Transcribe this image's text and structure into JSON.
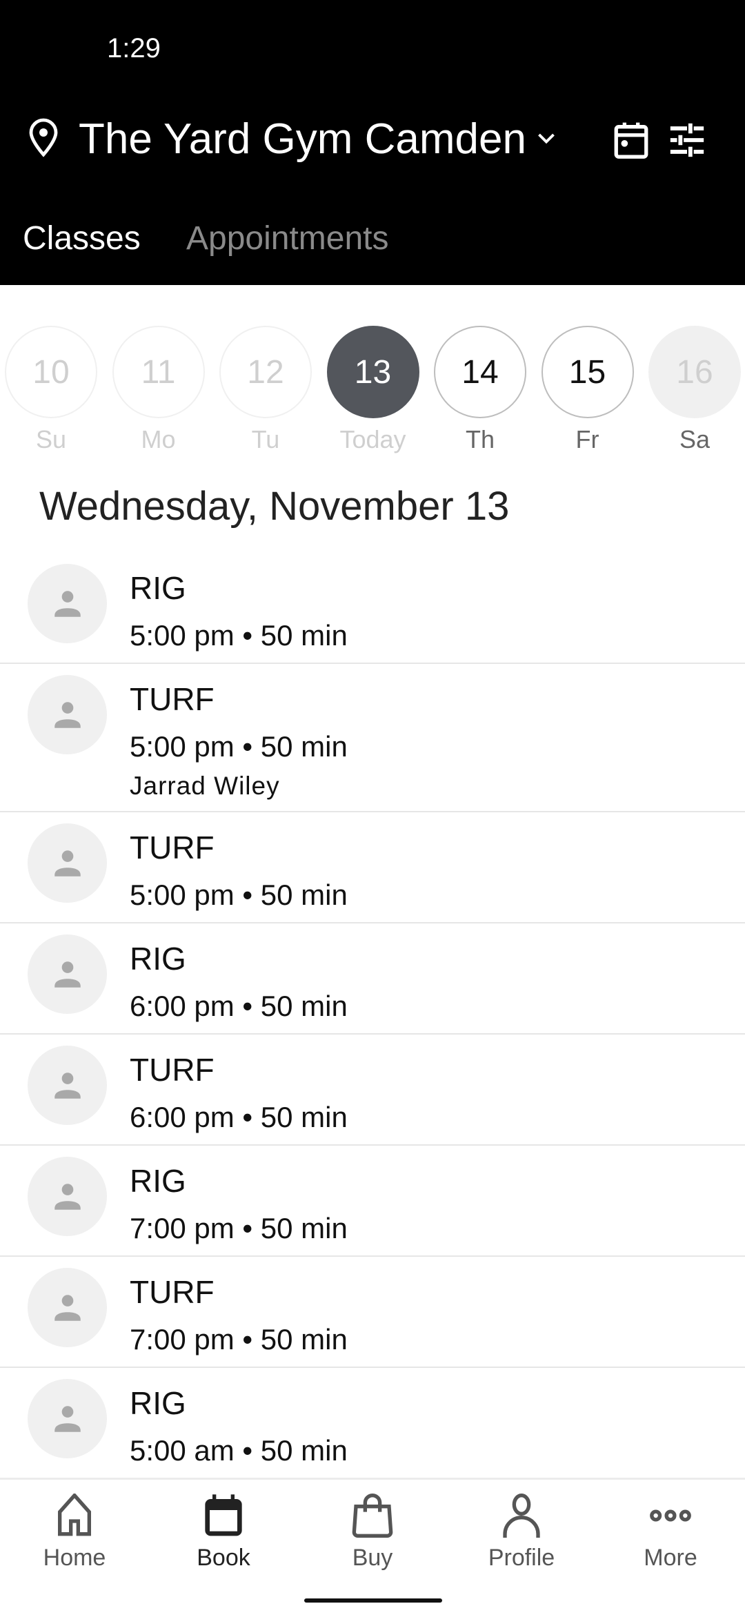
{
  "status_bar": {
    "time": "1:29"
  },
  "header": {
    "location": "The Yard Gym Camden",
    "icons": [
      "map-pin-icon",
      "chevron-down-icon",
      "calendar-icon",
      "filter-sliders-icon"
    ]
  },
  "tabs": [
    {
      "label": "Classes",
      "active": true
    },
    {
      "label": "Appointments",
      "active": false
    }
  ],
  "days": [
    {
      "num": "10",
      "label": "Su",
      "state": "past"
    },
    {
      "num": "11",
      "label": "Mo",
      "state": "past"
    },
    {
      "num": "12",
      "label": "Tu",
      "state": "past"
    },
    {
      "num": "13",
      "label": "Today",
      "state": "selected"
    },
    {
      "num": "14",
      "label": "Th",
      "state": "available"
    },
    {
      "num": "15",
      "label": "Fr",
      "state": "available"
    },
    {
      "num": "16",
      "label": "Sa",
      "state": "unavailable"
    }
  ],
  "date_heading": "Wednesday, November 13",
  "classes": [
    {
      "name": "RIG",
      "time": "5:00 pm • 50 min"
    },
    {
      "name": "TURF",
      "time": "5:00 pm • 50 min",
      "instructor": "Jarrad Wiley"
    },
    {
      "name": "TURF",
      "time": "5:00 pm • 50 min"
    },
    {
      "name": "RIG",
      "time": "6:00 pm • 50 min"
    },
    {
      "name": "TURF",
      "time": "6:00 pm • 50 min"
    },
    {
      "name": "RIG",
      "time": "7:00 pm • 50 min"
    },
    {
      "name": "TURF",
      "time": "7:00 pm • 50 min"
    },
    {
      "name": "RIG",
      "time": "5:00 am • 50 min"
    }
  ],
  "nav": [
    {
      "label": "Home"
    },
    {
      "label": "Book",
      "active": true
    },
    {
      "label": "Buy"
    },
    {
      "label": "Profile"
    },
    {
      "label": "More"
    }
  ],
  "colors": {
    "header_bg": "#000000",
    "selected_day": "#53565c",
    "avatar_bg": "#f0f0f0"
  }
}
